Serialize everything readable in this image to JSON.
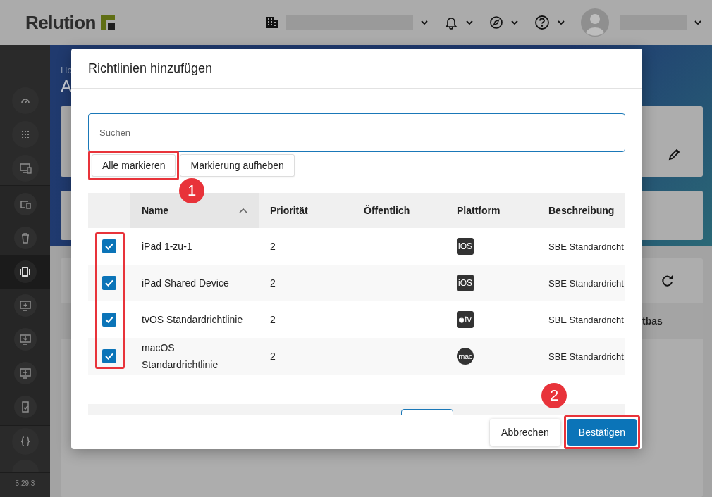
{
  "topbar": {
    "logo": "Relution"
  },
  "sidebar": {
    "items": [
      {
        "selected": false
      },
      {
        "selected": false
      },
      {
        "selected": false
      },
      {
        "selected": false
      },
      {
        "selected": false
      },
      {
        "selected": true
      },
      {
        "selected": false
      },
      {
        "selected": false
      },
      {
        "selected": false
      },
      {
        "selected": false
      },
      {
        "selected": false
      }
    ],
    "version": "5.29.3"
  },
  "page": {
    "breadcrumb": "Ho",
    "title": "A",
    "column_fragment": "tbas"
  },
  "dialog": {
    "title": "Richtlinien hinzufügen",
    "search": {
      "placeholder": "Suchen"
    },
    "actions": [
      {
        "label": "Alle markieren",
        "highlighted": true
      },
      {
        "label": "Markierung aufheben",
        "highlighted": false
      }
    ],
    "table": {
      "checkbox_column_highlighted": true,
      "columns": [
        {
          "label": "Name",
          "sorted": true
        },
        {
          "label": "Priorität",
          "sorted": false
        },
        {
          "label": "Öffentlich",
          "sorted": false
        },
        {
          "label": "Plattform",
          "sorted": false
        },
        {
          "label": "Beschreibung",
          "sorted": false
        }
      ],
      "rows": [
        {
          "checked": true,
          "name": "iPad 1-zu-1",
          "priority": "2",
          "platform": {
            "kind": "ios",
            "label": "iOS"
          },
          "description": "SBE Standardricht"
        },
        {
          "checked": true,
          "name": "iPad Shared Device",
          "priority": "2",
          "platform": {
            "kind": "ios",
            "label": "iOS"
          },
          "description": "SBE Standardricht"
        },
        {
          "checked": true,
          "name": "tvOS Standardrichtlinie",
          "priority": "2",
          "platform": {
            "kind": "tvos",
            "label": "tv"
          },
          "description": "SBE Standardricht"
        },
        {
          "checked": true,
          "name": "macOS Standardrichtlinie",
          "priority": "2",
          "platform": {
            "kind": "mac",
            "label": "mac"
          },
          "description": "SBE Standardricht"
        }
      ]
    },
    "buttons": [
      {
        "label": "Abbrechen",
        "kind": "secondary",
        "highlighted": false
      },
      {
        "label": "Bestätigen",
        "kind": "primary",
        "highlighted": true
      }
    ],
    "annotations": [
      {
        "number": "1"
      },
      {
        "number": "2"
      }
    ]
  }
}
